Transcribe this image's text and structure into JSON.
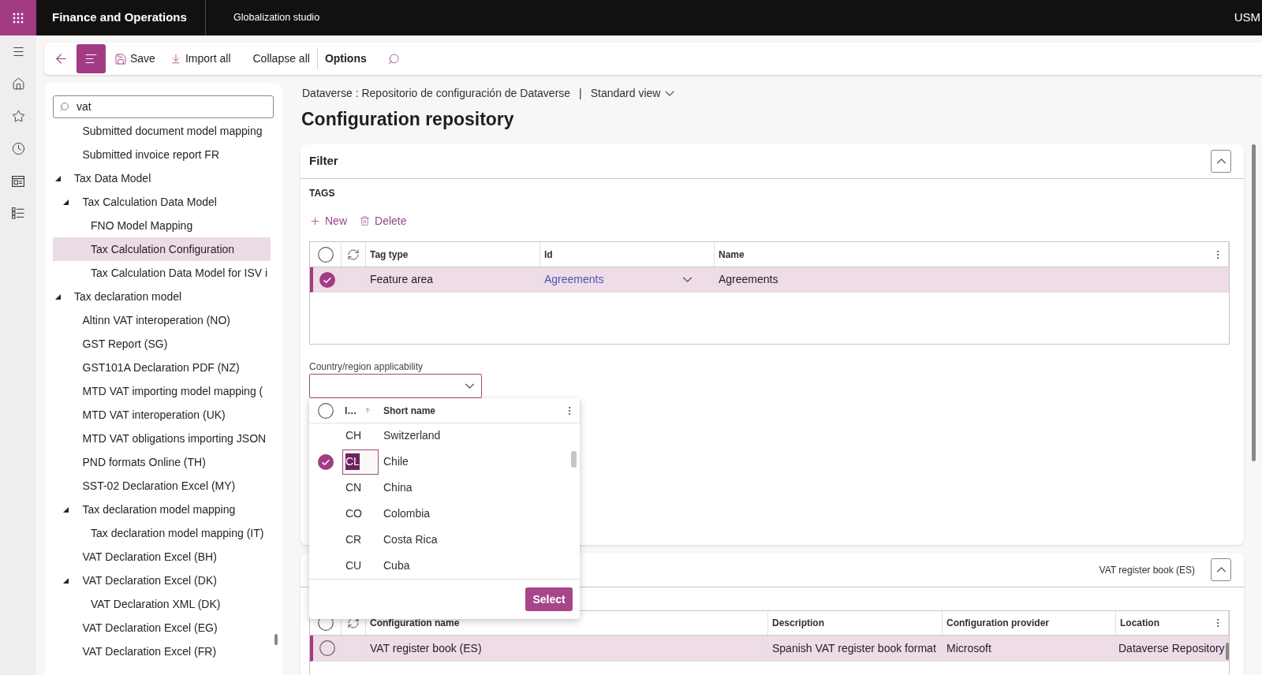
{
  "app_bar": {
    "title": "Finance and Operations",
    "workspace": "Globalization studio",
    "company": "USM"
  },
  "action_pane": {
    "list_toggle_on": true,
    "save": "Save",
    "import_all": "Import all",
    "collapse_all": "Collapse all",
    "options": "Options"
  },
  "navigation_tree": {
    "search": {
      "value": "vat"
    },
    "leading_children": [
      {
        "label": "Submitted document model mapping",
        "selected": false
      },
      {
        "label": "Submitted invoice report FR",
        "selected": false
      }
    ],
    "nodes": [
      {
        "label": "Tax Data Model",
        "selected": false,
        "expanded": true,
        "children": [
          {
            "label": "Tax Calculation Data Model",
            "selected": false,
            "expanded": true,
            "children": [
              {
                "label": "FNO Model Mapping",
                "selected": false
              },
              {
                "label": "Tax Calculation Configuration",
                "selected": true
              },
              {
                "label": "Tax Calculation Data Model for ISV i",
                "selected": false
              }
            ]
          }
        ]
      },
      {
        "label": "Tax declaration model",
        "selected": false,
        "expanded": true,
        "children": [
          {
            "label": "Altinn VAT interoperation (NO)",
            "selected": false
          },
          {
            "label": "GST Report (SG)",
            "selected": false
          },
          {
            "label": "GST101A Declaration PDF (NZ)",
            "selected": false
          },
          {
            "label": "MTD VAT importing model mapping (",
            "selected": false
          },
          {
            "label": "MTD VAT interoperation (UK)",
            "selected": false
          },
          {
            "label": "MTD VAT obligations importing JSON",
            "selected": false
          },
          {
            "label": "PND formats Online (TH)",
            "selected": false
          },
          {
            "label": "SST-02 Declaration Excel (MY)",
            "selected": false
          },
          {
            "label": "Tax declaration model mapping",
            "selected": false,
            "expanded": true,
            "children": [
              {
                "label": "Tax declaration model mapping (IT)",
                "selected": false
              }
            ]
          },
          {
            "label": "VAT Declaration Excel (BH)",
            "selected": false
          },
          {
            "label": "VAT Declaration Excel (DK)",
            "selected": false,
            "expanded": true,
            "children": [
              {
                "label": "VAT Declaration XML (DK)",
                "selected": false
              }
            ]
          },
          {
            "label": "VAT Declaration Excel (EG)",
            "selected": false
          },
          {
            "label": "VAT Declaration Excel (FR)",
            "selected": false
          }
        ]
      }
    ]
  },
  "breadcrumb": {
    "source": "Dataverse : Repositorio de configuración de Dataverse",
    "separator": "|",
    "view": "Standard view"
  },
  "page_title": "Configuration repository",
  "filter_card": {
    "title": "Filter",
    "expanded": true,
    "tags_heading": "TAGS",
    "new": "New",
    "delete": "Delete",
    "tags_grid": {
      "columns": [
        "Tag type",
        "Id",
        "Name"
      ],
      "rows": [
        {
          "tag_type": "Feature area",
          "id": "Agreements",
          "name": "Agreements",
          "selected": true,
          "checked": true
        }
      ]
    },
    "country_field": {
      "label": "Country/region applicability"
    }
  },
  "country_lookup": {
    "columns": [
      "I…",
      "Short name"
    ],
    "rows": [
      {
        "id": "CH",
        "name": "Switzerland",
        "checked": false,
        "focused": false
      },
      {
        "id": "CL",
        "name": "Chile",
        "checked": true,
        "focused": true
      },
      {
        "id": "CN",
        "name": "China",
        "checked": false,
        "focused": false
      },
      {
        "id": "CO",
        "name": "Colombia",
        "checked": false,
        "focused": false
      },
      {
        "id": "CR",
        "name": "Costa Rica",
        "checked": false,
        "focused": false
      },
      {
        "id": "CU",
        "name": "Cuba",
        "checked": false,
        "focused": false
      }
    ],
    "select": "Select"
  },
  "configurations_card": {
    "summary": "VAT register book (ES)",
    "expanded": true,
    "grid": {
      "columns": [
        "Configuration name",
        "Description",
        "Configuration provider",
        "Location"
      ],
      "rows": [
        {
          "cells": [
            "VAT register book (ES)",
            "Spanish VAT register book format",
            "Microsoft",
            "Dataverse Repository"
          ],
          "selected": true,
          "checked": false
        }
      ]
    }
  }
}
